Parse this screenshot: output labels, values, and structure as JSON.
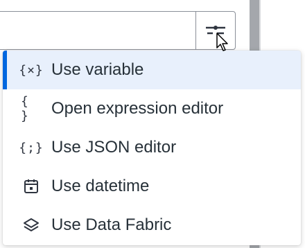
{
  "menu": {
    "items": [
      {
        "label": "Use variable",
        "icon": "variable-icon",
        "glyph": "{×}",
        "selected": true
      },
      {
        "label": "Open expression editor",
        "icon": "braces-icon",
        "glyph": "{ }"
      },
      {
        "label": "Use JSON editor",
        "icon": "json-icon",
        "glyph": "{;}"
      },
      {
        "label": "Use datetime",
        "icon": "calendar-icon"
      },
      {
        "label": "Use Data Fabric",
        "icon": "layers-icon"
      }
    ]
  },
  "colors": {
    "accent": "#0067df",
    "selected_bg": "#e8f0fc",
    "text": "#273139",
    "scrollbar": "#a4a7ac"
  }
}
